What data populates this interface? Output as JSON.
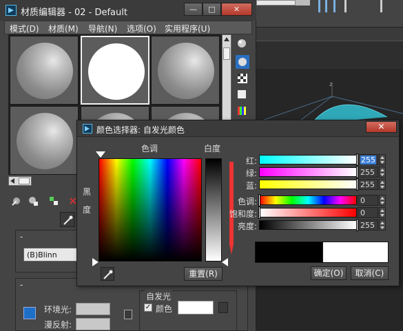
{
  "material_editor": {
    "title": "材质编辑器 - 02 - Default",
    "window_buttons": [
      "—",
      "□",
      "✕"
    ],
    "menu": [
      "模式(D)",
      "材质(M)",
      "导航(N)",
      "选项(O)",
      "实用程序(U)"
    ],
    "shader": "(B)Blinn",
    "ambient_label": "环境光:",
    "diffuse_label": "漫反射:",
    "self_illum_title": "自发光",
    "self_illum_color_label": "颜色",
    "self_illum_checked": "✓",
    "rollout_collapse": "-",
    "colors": {
      "self_illum": "#ffffff",
      "ambient": "#c8c8c8",
      "diffuse": "#c8c8c8"
    }
  },
  "color_selector": {
    "title": "颜色选择器: 自发光颜色",
    "close_label": "✕",
    "hue_label": "色调",
    "whiteness_label": "白度",
    "blackness_label_1": "黑",
    "blackness_label_2": "度",
    "reset_button": "重置(R)",
    "ok_button": "确定(O)",
    "cancel_button": "取消(C)",
    "channels": [
      {
        "label": "红:",
        "value": "255",
        "selected": true
      },
      {
        "label": "绿:",
        "value": "255"
      },
      {
        "label": "蓝:",
        "value": "255"
      },
      {
        "label": "色调:",
        "value": "0"
      },
      {
        "label": "饱和度:",
        "value": "0"
      },
      {
        "label": "亮度:",
        "value": "255"
      }
    ],
    "preview_old": "#000000",
    "preview_new": "#ffffff"
  },
  "viewport": {
    "axis_label": "z"
  }
}
